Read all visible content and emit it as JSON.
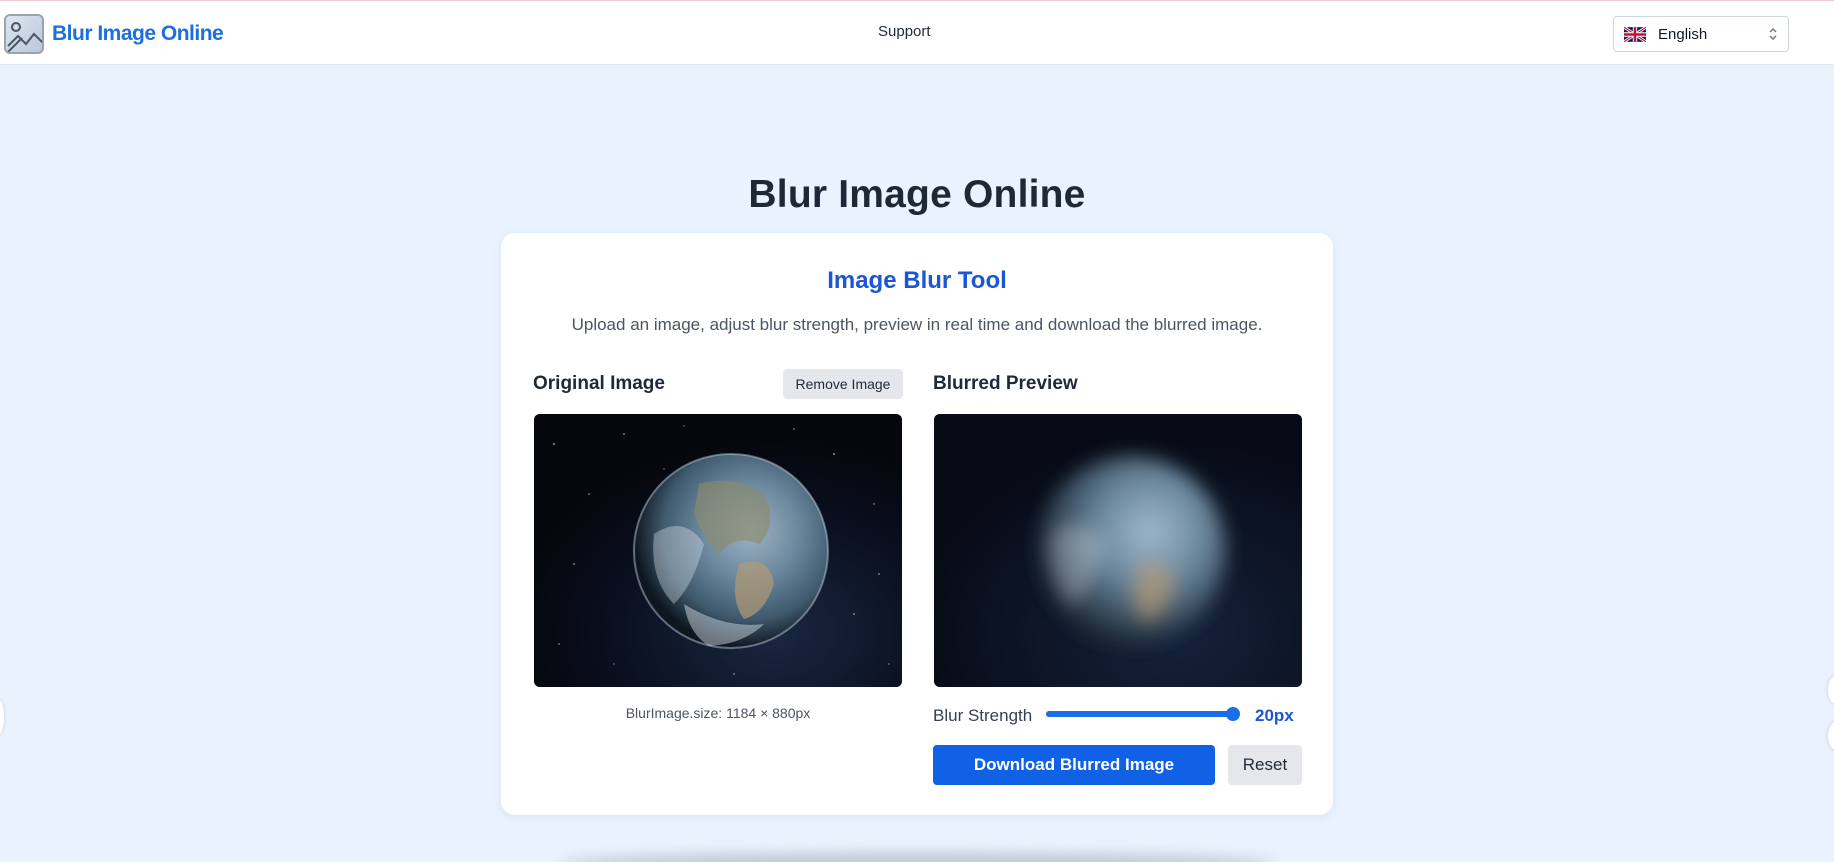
{
  "header": {
    "logo_text": "Blur Image Online",
    "nav_support": "Support",
    "language": "English",
    "flag_icon": "uk-flag-icon"
  },
  "main": {
    "title": "Blur Image Online",
    "tool": {
      "title": "Image Blur Tool",
      "description": "Upload an image, adjust blur strength, preview in real time and download the blurred image.",
      "original_label": "Original Image",
      "remove_button": "Remove Image",
      "blurred_label": "Blurred Preview",
      "size_text": "BlurImage.size: 1184 × 880px",
      "blur_strength_label": "Blur Strength",
      "blur_strength_value": "20px",
      "blur_strength_fraction": 1.0,
      "download_button": "Download Blurred Image",
      "reset_button": "Reset"
    }
  },
  "colors": {
    "accent": "#1a56d6",
    "primary_button": "#1061e6",
    "page_bg": "#eaf3fd"
  }
}
